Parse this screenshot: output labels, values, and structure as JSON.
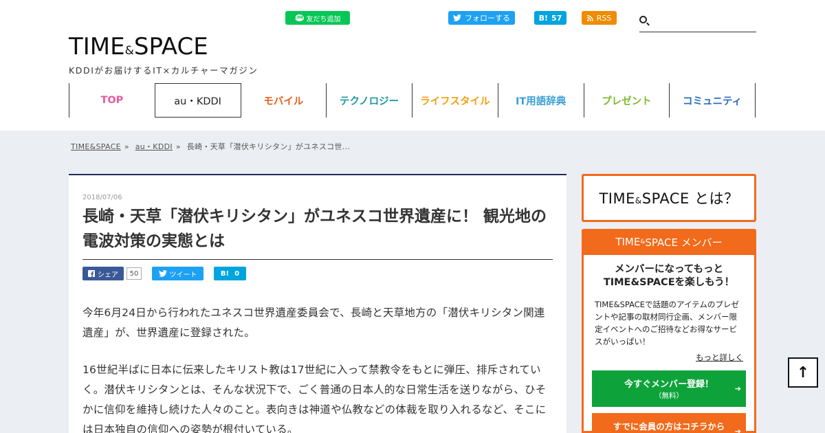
{
  "header": {
    "line_button": "友だち追加",
    "twitter_follow": "フォローする",
    "hatena_label": "B!",
    "hatena_count": "57",
    "rss_label": "RSS",
    "search_placeholder": "",
    "logo_left": "TIME",
    "logo_amp": "&",
    "logo_right": "SPACE",
    "logo_tagline": "KDDIがお届けするIT×カルチャーマガジン"
  },
  "nav": {
    "items": [
      {
        "label": "TOP",
        "color": "#e85a9b"
      },
      {
        "label": "au・KDDI",
        "color": "#222222"
      },
      {
        "label": "モバイル",
        "color": "#e8611a"
      },
      {
        "label": "テクノロジー",
        "color": "#1a9aa0"
      },
      {
        "label": "ライフスタイル",
        "color": "#f0a00f"
      },
      {
        "label": "IT用語辞典",
        "color": "#3b9fd6"
      },
      {
        "label": "プレゼント",
        "color": "#7cbb2c"
      },
      {
        "label": "コミュニティ",
        "color": "#2a6bbf"
      }
    ],
    "active_index": 1
  },
  "breadcrumb": {
    "home": "TIME&SPACE",
    "sep": "»",
    "category": "au・KDDI",
    "current": "長崎・天草「潜伏キリシタン」がユネスコ世..."
  },
  "article": {
    "date": "2018/07/06",
    "title": "長崎・天草「潜伏キリシタン」がユネスコ世界遺産に！ 観光地の電波対策の実態とは",
    "share": {
      "fb_label": "シェア",
      "fb_count": "50",
      "tw_label": "ツイート",
      "hb_label": "B!",
      "hb_count": "0"
    },
    "para1": "今年6月24日から行われたユネスコ世界遺産委員会で、長崎と天草地方の「潜伏キリシタン関連遺産」が、世界遺産に登録された。",
    "para2": "16世紀半ばに日本に伝来したキリスト教は17世紀に入って禁教令をもとに弾圧、排斥されていく。潜伏キリシタンとは、そんな状況下で、ごく普通の日本人的な日常生活を送りながら、ひそかに信仰を維持し続けた人々のこと。表向きは神道や仏教などの体裁を取り入れるなど、そこには日本独自の信仰への姿勢が根付いている。"
  },
  "sidebar": {
    "about_left": "TIME",
    "about_amp": "&",
    "about_right": "SPACE",
    "about_suffix": "とは？",
    "member_head_left": "TIME",
    "member_head_amp": "&",
    "member_head_right": "SPACE メンバー",
    "member_lead_1": "メンバーになってもっと",
    "member_lead_2": "TIME&SPACEを楽しもう！",
    "member_desc": "TIME&SPACEで話題のアイテムのプレゼントや記事の取材同行企画、メンバー限定イベントへのご招待などお得なサービスがいっぱい！",
    "more_link": "もっと詳しく",
    "register_label": "今すぐメンバー登録！",
    "register_sub": "（無料）",
    "login_label": "すでに会員の方はコチラから",
    "arrow": "➔"
  },
  "to_top": "↑",
  "colors": {
    "accent": "#f26a1b",
    "navy": "#1e2a55",
    "register_green": "#0ea33a",
    "bg": "#ebeef3"
  }
}
